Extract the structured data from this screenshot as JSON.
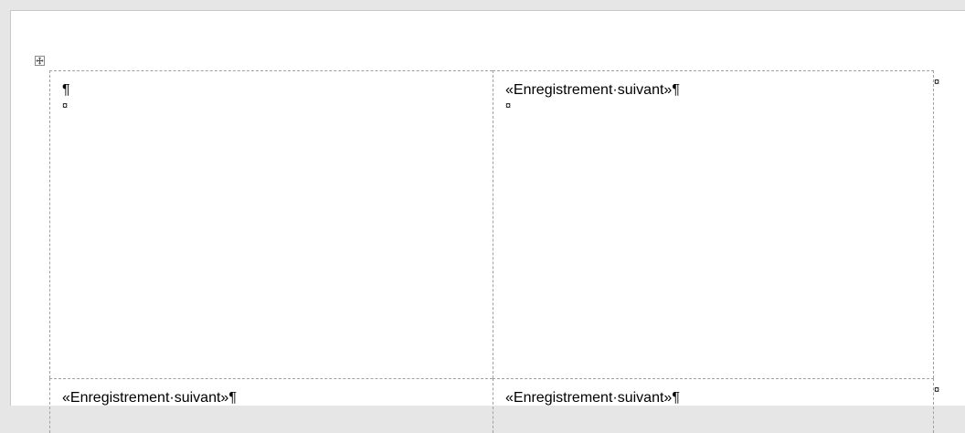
{
  "document": {
    "table": {
      "rows": [
        {
          "cells": [
            {
              "text": "¶",
              "end_mark": "¤"
            },
            {
              "text": "«Enregistrement·suivant»¶",
              "end_mark": "¤"
            }
          ],
          "row_end_mark": "¤"
        },
        {
          "cells": [
            {
              "text": "«Enregistrement·suivant»¶"
            },
            {
              "text": "«Enregistrement·suivant»¶"
            }
          ],
          "row_end_mark": "¤"
        }
      ]
    },
    "icons": {
      "table_move_handle": "four-way-arrow-icon"
    }
  }
}
